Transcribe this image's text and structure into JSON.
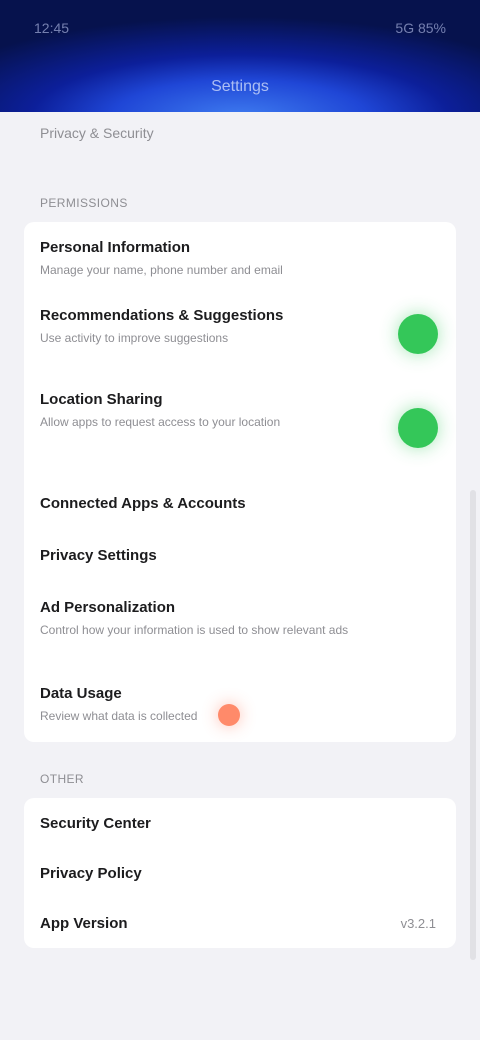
{
  "header": {
    "status_left": "12:45",
    "status_right": "5G  85%",
    "title": "Settings"
  },
  "page_subtitle": "Privacy & Security",
  "section_general": {
    "label": "PERMISSIONS",
    "items": [
      {
        "title": "Personal Information",
        "desc": "Manage your name, phone number and email"
      },
      {
        "title": "Recommendations & Suggestions",
        "desc": "Use activity to improve suggestions",
        "toggle_on": true
      },
      {
        "title": "Location Sharing",
        "desc": "Allow apps to request access to your location",
        "toggle_on": true
      },
      {
        "title": "Connected Apps & Accounts",
        "desc": ""
      },
      {
        "title": "Privacy Settings",
        "desc": ""
      },
      {
        "title": "Ad Personalization",
        "desc": "Control how your information is used to show relevant ads"
      },
      {
        "title": "Data Usage",
        "desc": "Review what data is collected",
        "alert": true
      }
    ]
  },
  "section_other": {
    "label": "OTHER",
    "items": [
      {
        "title": "Security Center",
        "value": ""
      },
      {
        "title": "Privacy Policy",
        "value": ""
      },
      {
        "title": "App Version",
        "value": "v3.2.1"
      }
    ]
  },
  "colors": {
    "header_top": "#06124d",
    "header_bottom": "#3f7cf0",
    "toggle_on": "#34c759",
    "alert": "#ff8a6a",
    "background": "#f2f2f6"
  }
}
